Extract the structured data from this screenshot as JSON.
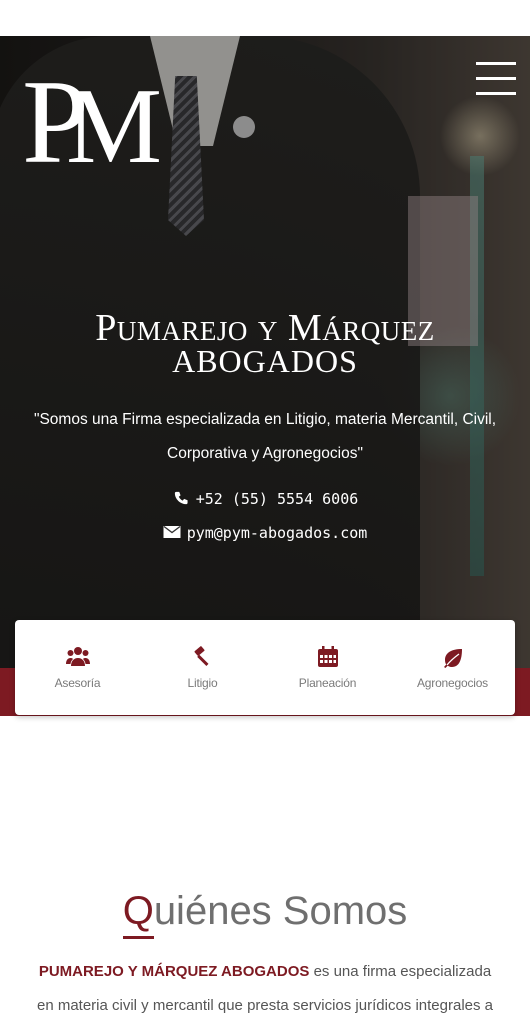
{
  "header": {
    "logo_text": "PM",
    "menu_icon": "hamburger-menu-icon"
  },
  "hero": {
    "title_line1": "Pumarejo y Márquez",
    "title_line2": "ABOGADOS",
    "slogan": "\"Somos una Firma especializada en Litigio, materia Mercantil, Civil, Corporativa y Agronegocios\"",
    "phone": "+52 (55) 5554 6006",
    "email": "pym@pym-abogados.com",
    "phone_icon": "phone-icon",
    "email_icon": "envelope-icon"
  },
  "services": [
    {
      "label": "Asesoría",
      "icon": "users-icon"
    },
    {
      "label": "Litigio",
      "icon": "gavel-icon"
    },
    {
      "label": "Planeación",
      "icon": "calendar-icon"
    },
    {
      "label": "Agronegocios",
      "icon": "leaf-icon"
    }
  ],
  "about": {
    "title_first_letter": "Q",
    "title_rest": "uiénes Somos",
    "firm_name": "PUMAREJO Y MÁRQUEZ ABOGADOS",
    "text": " es una firma especializada en materia civil y mercantil que presta servicios jurídicos integrales a"
  },
  "colors": {
    "brand": "#7d1a22",
    "text_gray": "#6f6f6f"
  }
}
